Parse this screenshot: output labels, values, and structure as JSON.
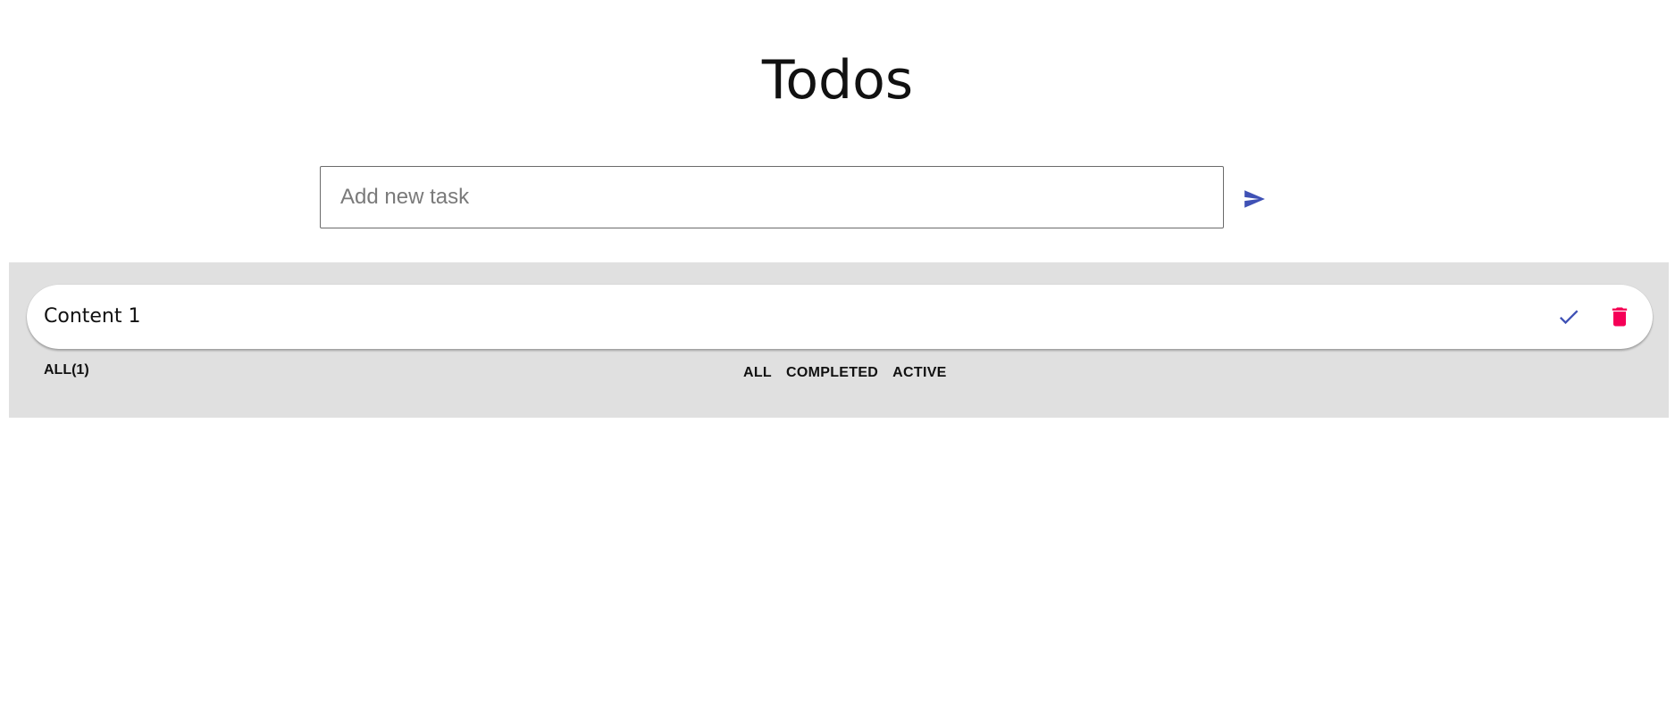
{
  "header": {
    "title": "Todos"
  },
  "new_task": {
    "placeholder": "Add new task",
    "value": ""
  },
  "icons": {
    "send": "send-icon",
    "complete": "check-icon",
    "delete": "trash-icon"
  },
  "colors": {
    "accent": "#3f51b5",
    "danger": "#f50057",
    "panel_bg": "#e0e0e0"
  },
  "todos": [
    {
      "text": "Content 1"
    }
  ],
  "footer": {
    "count_label": "ALL(1)",
    "filters": [
      "ALL",
      "COMPLETED",
      "ACTIVE"
    ]
  }
}
